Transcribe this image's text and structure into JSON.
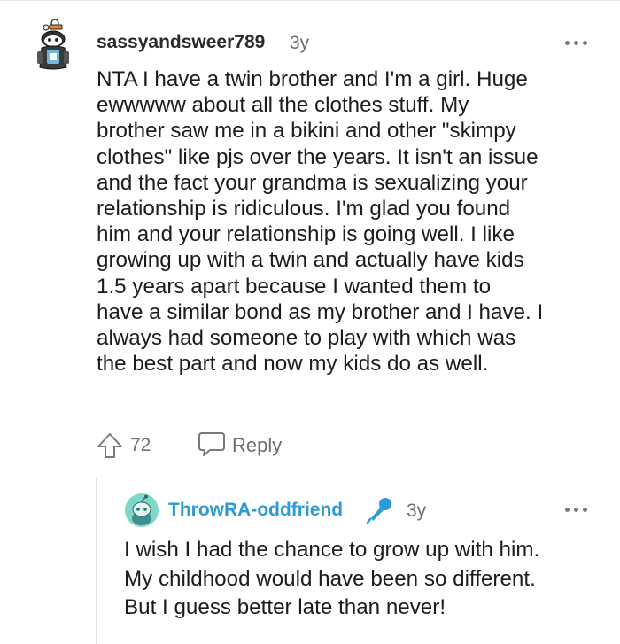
{
  "comment": {
    "username": "sassyandsweer789",
    "time": "3y",
    "lines": [
      "NTA I have a twin brother and I'm a girl. Huge",
      "ewwwww about all the clothes stuff. My",
      "brother saw me in a bikini and other \"skimpy",
      "clothes\" like pjs over the years. It isn't an issue",
      "and the fact your grandma is sexualizing your",
      "relationship is ridiculous. I'm glad you found",
      "him and your relationship is going well. I like",
      "growing up with a twin and actually have kids",
      "1.5 years apart because I wanted them to",
      "have a similar bond as my brother and I have. I",
      "always had someone to play with which was",
      "the best part and now my kids do as well."
    ],
    "votes": "72",
    "reply_label": "Reply",
    "icons": {
      "avatar": "snoo-avatar-icon",
      "upvote": "upvote-arrow-icon",
      "reply": "comment-bubble-icon",
      "more": "more-options-icon"
    }
  },
  "reply": {
    "username": "ThrowRA-oddfriend",
    "time": "3y",
    "lines": [
      "I wish I had the chance to grow up with him.",
      "My childhood would have been so different.",
      "But I guess better late than never!"
    ],
    "icons": {
      "avatar": "snoo-avatar-icon",
      "op_badge": "microphone-icon",
      "more": "more-options-icon"
    }
  },
  "colors": {
    "username_reply": "#2b9ad6",
    "mic": "#2b9ad6",
    "meta": "#6f6f6f",
    "text": "#1c1c1c"
  }
}
